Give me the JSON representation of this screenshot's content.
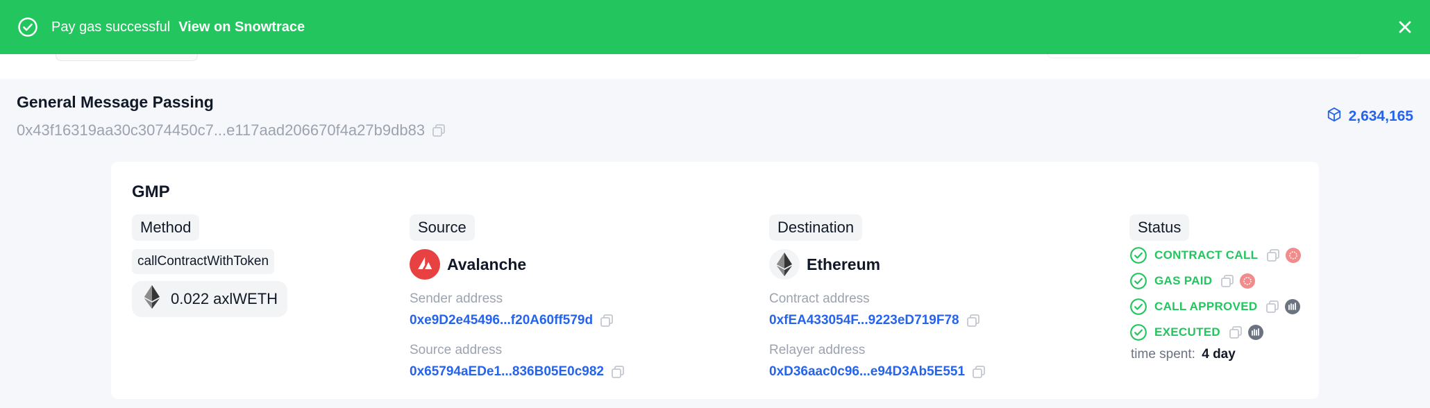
{
  "toast": {
    "message": "Pay gas successful",
    "link": "View on Snowtrace",
    "color": "#22c55e"
  },
  "header": {
    "title": "General Message Passing",
    "tx_hash": "0x43f16319aa30c3074450c7...e117aad206670f4a27b9db83",
    "block_number": "2,634,165"
  },
  "card": {
    "title": "GMP",
    "method": {
      "heading": "Method",
      "name": "callContractWithToken",
      "amount": "0.022 axlWETH",
      "amount_icon": "ethereum-icon"
    },
    "source": {
      "heading": "Source",
      "chain": "Avalanche",
      "chain_icon": "avalanche-icon",
      "sender_label": "Sender address",
      "sender_value": "0xe9D2e45496...f20A60ff579d",
      "source_label": "Source address",
      "source_value": "0x65794aEDe1...836B05E0c982"
    },
    "destination": {
      "heading": "Destination",
      "chain": "Ethereum",
      "chain_icon": "ethereum-icon",
      "contract_label": "Contract address",
      "contract_value": "0xfEA433054F...9223eD719F78",
      "relayer_label": "Relayer address",
      "relayer_value": "0xD36aac0c96...e94D3Ab5E551"
    },
    "status": {
      "heading": "Status",
      "steps": [
        {
          "label": "CONTRACT CALL",
          "chain_icon": "avalanche-icon"
        },
        {
          "label": "GAS PAID",
          "chain_icon": "avalanche-icon"
        },
        {
          "label": "CALL APPROVED",
          "chain_icon": "axelar-icon"
        },
        {
          "label": "EXECUTED",
          "chain_icon": "axelar-icon"
        }
      ],
      "time_spent_label": "time spent:",
      "time_spent_value": "4 day"
    }
  },
  "colors": {
    "link_blue": "#2563eb",
    "success_green": "#22c55e",
    "avalanche_red": "#e84142",
    "muted_gray": "#9ca3af"
  }
}
